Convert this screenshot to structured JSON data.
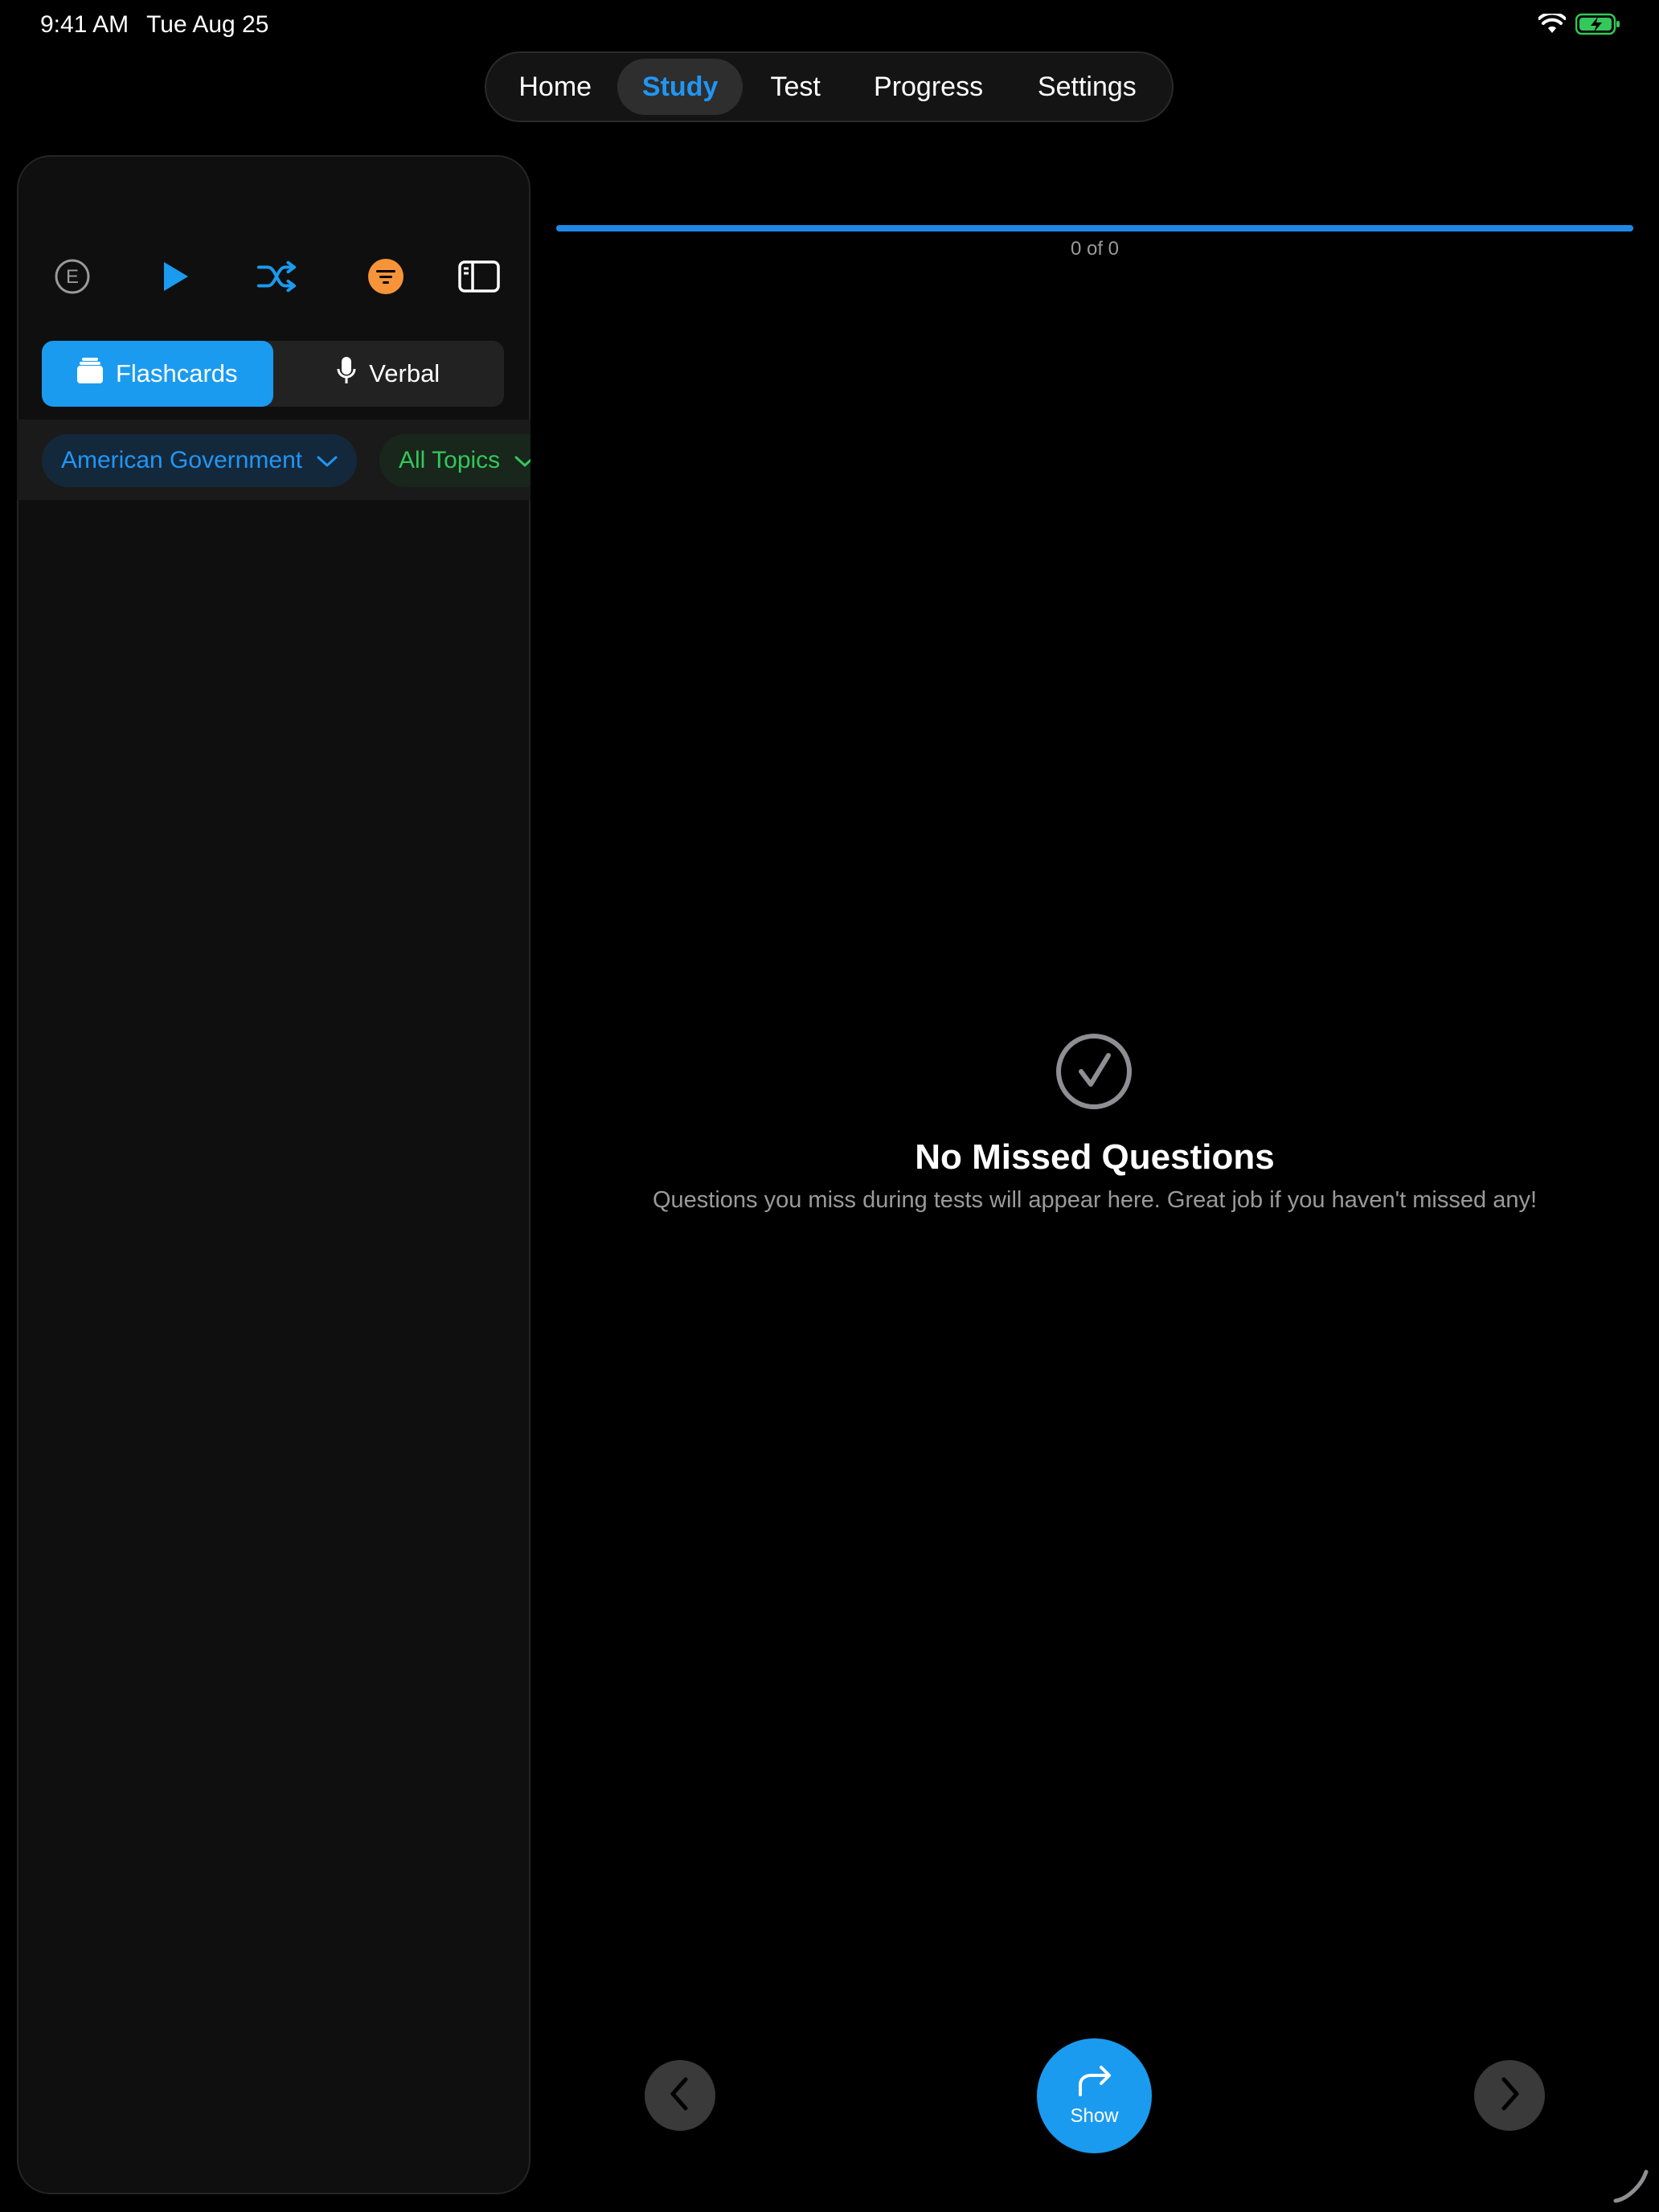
{
  "status_bar": {
    "time": "9:41 AM",
    "date": "Tue Aug 25"
  },
  "tabs": [
    {
      "label": "Home",
      "active": false
    },
    {
      "label": "Study",
      "active": true
    },
    {
      "label": "Test",
      "active": false
    },
    {
      "label": "Progress",
      "active": false
    },
    {
      "label": "Settings",
      "active": false
    }
  ],
  "sidebar": {
    "toolbar_icons": [
      "explicit-e-icon",
      "play-icon",
      "shuffle-icon",
      "filter-icon",
      "sidebar-toggle-icon"
    ],
    "modes": [
      {
        "label": "Flashcards",
        "icon": "cards-icon",
        "active": true
      },
      {
        "label": "Verbal",
        "icon": "microphone-icon",
        "active": false
      }
    ],
    "filters": {
      "category": "American Government",
      "topic": "All Topics"
    }
  },
  "main": {
    "progress": {
      "label": "0 of 0",
      "fraction": 0
    },
    "empty_state": {
      "icon": "checkmark-circle-icon",
      "title": "No Missed Questions",
      "subtitle": "Questions you miss during tests will appear here. Great job if you haven't missed any!"
    },
    "controls": {
      "prev_icon": "chevron-left-icon",
      "show_label": "Show",
      "show_icon": "flip-arrow-icon",
      "next_icon": "chevron-right-icon"
    }
  },
  "colors": {
    "accent": "#1a9bf0",
    "topic_green": "#34c759",
    "filter_orange": "#f7943a",
    "battery_green": "#34c759"
  }
}
